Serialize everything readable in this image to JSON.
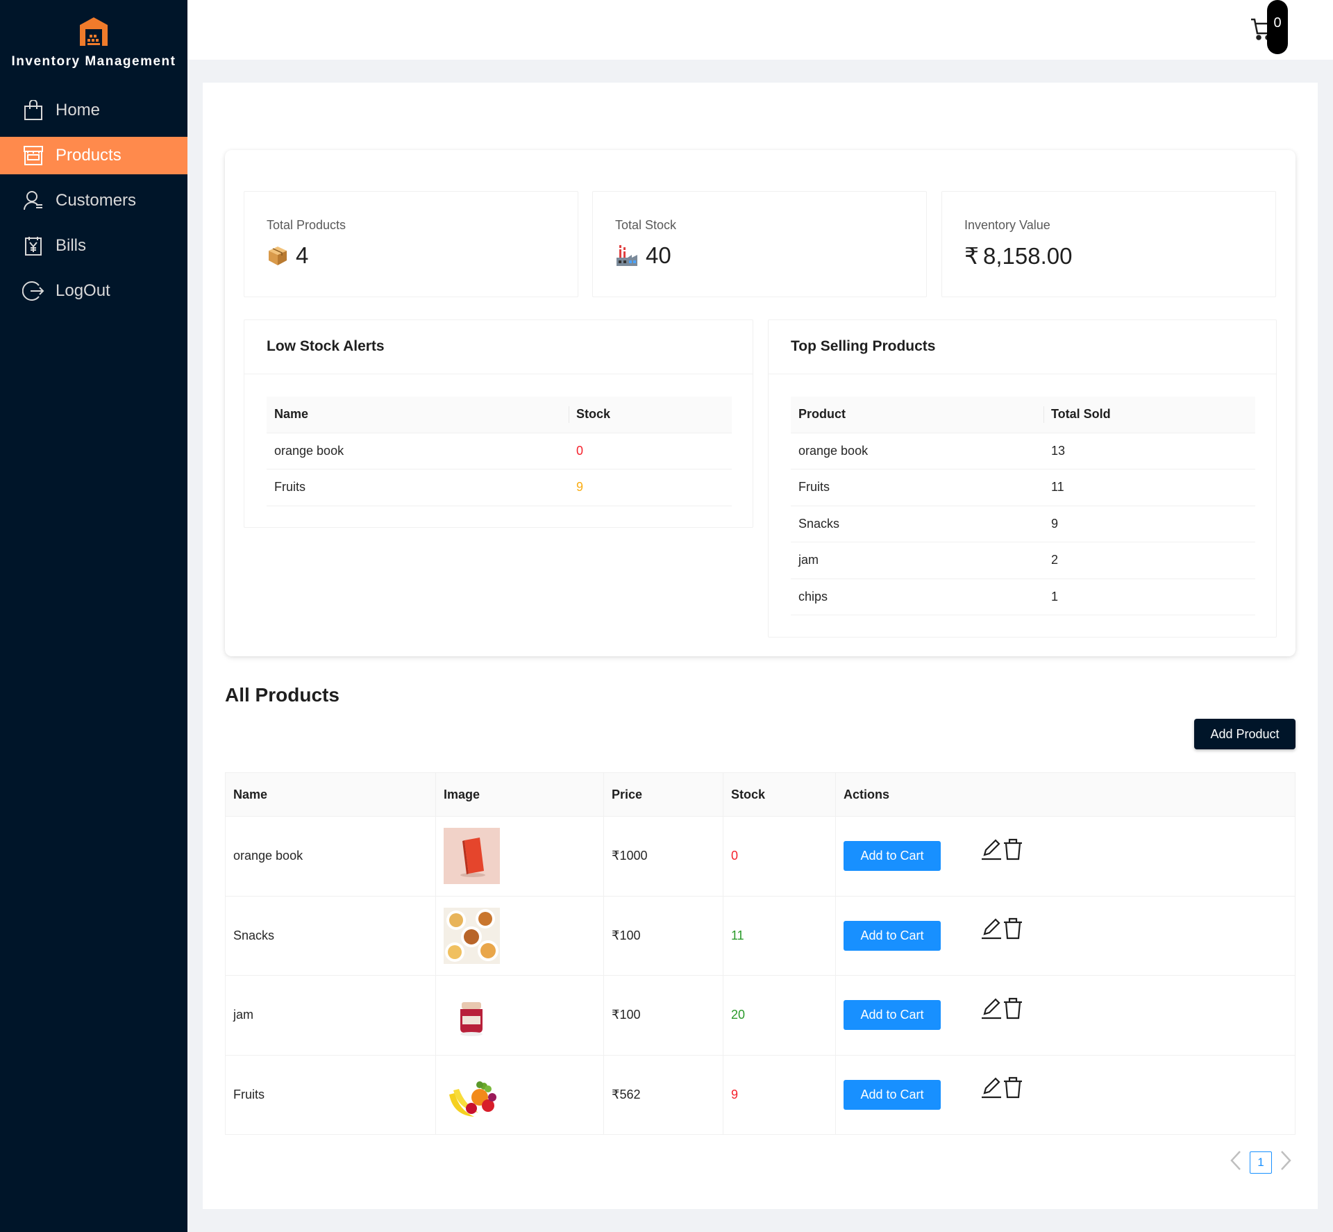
{
  "sidebar": {
    "brand": "Inventory Management",
    "items": [
      {
        "label": "Home",
        "icon": "shopping-bag-icon"
      },
      {
        "label": "Products",
        "icon": "shop-icon",
        "active": true
      },
      {
        "label": "Customers",
        "icon": "user-icon"
      },
      {
        "label": "Bills",
        "icon": "account-book-icon"
      },
      {
        "label": "LogOut",
        "icon": "logout-icon"
      }
    ]
  },
  "header": {
    "cart_count": "0"
  },
  "stats": {
    "total_products": {
      "title": "Total Products",
      "value": "4"
    },
    "total_stock": {
      "title": "Total Stock",
      "value": "40"
    },
    "inventory_value": {
      "title": "Inventory Value",
      "prefix": "₹",
      "value": "8,158.00"
    }
  },
  "low_stock": {
    "title": "Low Stock Alerts",
    "columns": [
      "Name",
      "Stock"
    ],
    "rows": [
      {
        "name": "orange book",
        "stock": "0"
      },
      {
        "name": "Fruits",
        "stock": "9"
      }
    ]
  },
  "top_selling": {
    "title": "Top Selling Products",
    "columns": [
      "Product",
      "Total Sold"
    ],
    "rows": [
      {
        "product": "orange book",
        "sold": "13"
      },
      {
        "product": "Fruits",
        "sold": "11"
      },
      {
        "product": "Snacks",
        "sold": "9"
      },
      {
        "product": "jam",
        "sold": "2"
      },
      {
        "product": "chips",
        "sold": "1"
      }
    ]
  },
  "products": {
    "title": "All Products",
    "add_label": "Add Product",
    "columns": [
      "Name",
      "Image",
      "Price",
      "Stock",
      "Actions"
    ],
    "cart_label": "Add to Cart",
    "rows": [
      {
        "name": "orange book",
        "price": "₹1000",
        "stock": "0"
      },
      {
        "name": "Snacks",
        "price": "₹100",
        "stock": "11"
      },
      {
        "name": "jam",
        "price": "₹100",
        "stock": "20"
      },
      {
        "name": "Fruits",
        "price": "₹562",
        "stock": "9"
      }
    ]
  },
  "pagination": {
    "current": "1"
  },
  "colors": {
    "sidebar_bg": "#001529",
    "active_item": "#ff8a4c",
    "primary": "#1890ff",
    "danger": "#f5222d",
    "warning": "#faad14",
    "success": "#2b9a2b"
  }
}
